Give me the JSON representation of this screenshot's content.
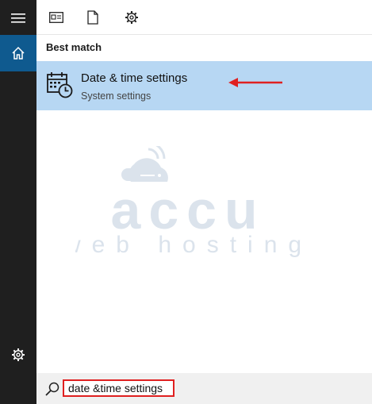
{
  "rail": {
    "items": [
      {
        "name": "menu",
        "icon": "hamburger-icon"
      },
      {
        "name": "home",
        "icon": "home-icon",
        "selected": true
      },
      {
        "name": "settings",
        "icon": "gear-icon"
      }
    ]
  },
  "toolbar": {
    "icons": [
      "apps-icon",
      "documents-icon",
      "settings-icon"
    ]
  },
  "results": {
    "section_label": "Best match",
    "items": [
      {
        "title": "Date & time settings",
        "subtitle": "System settings",
        "icon": "calendar-clock-icon"
      }
    ]
  },
  "watermark": {
    "line1": "accu",
    "line2": "web hosting"
  },
  "search": {
    "value": "date &time settings"
  },
  "colors": {
    "rail_bg": "#1f1f1f",
    "home_selected": "#0f5a8f",
    "result_highlight": "#b7d7f3",
    "annotation_red": "#e02020",
    "watermark": "#dbe3ec"
  }
}
